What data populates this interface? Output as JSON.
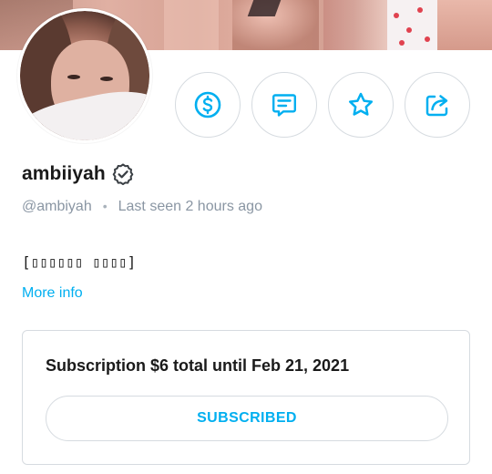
{
  "profile": {
    "display_name": "ambiiyah",
    "username": "@ambiyah",
    "separator": "•",
    "last_seen": "Last seen 2 hours ago",
    "bio": "[▯▯▯▯▯▯ ▯▯▯▯]",
    "more_info_label": "More info",
    "verified_icon": "verified-badge-icon"
  },
  "actions": [
    {
      "name": "tip-button",
      "icon": "dollar-circle-icon"
    },
    {
      "name": "message-button",
      "icon": "message-icon"
    },
    {
      "name": "favorite-button",
      "icon": "star-icon"
    },
    {
      "name": "share-button",
      "icon": "share-icon"
    }
  ],
  "subscription": {
    "title": "Subscription $6 total until Feb 21, 2021",
    "button_label": "SUBSCRIBED"
  },
  "colors": {
    "accent": "#00aff0",
    "text": "#1a1a1a",
    "muted": "#8a96a3",
    "border": "#d6dbe0"
  }
}
